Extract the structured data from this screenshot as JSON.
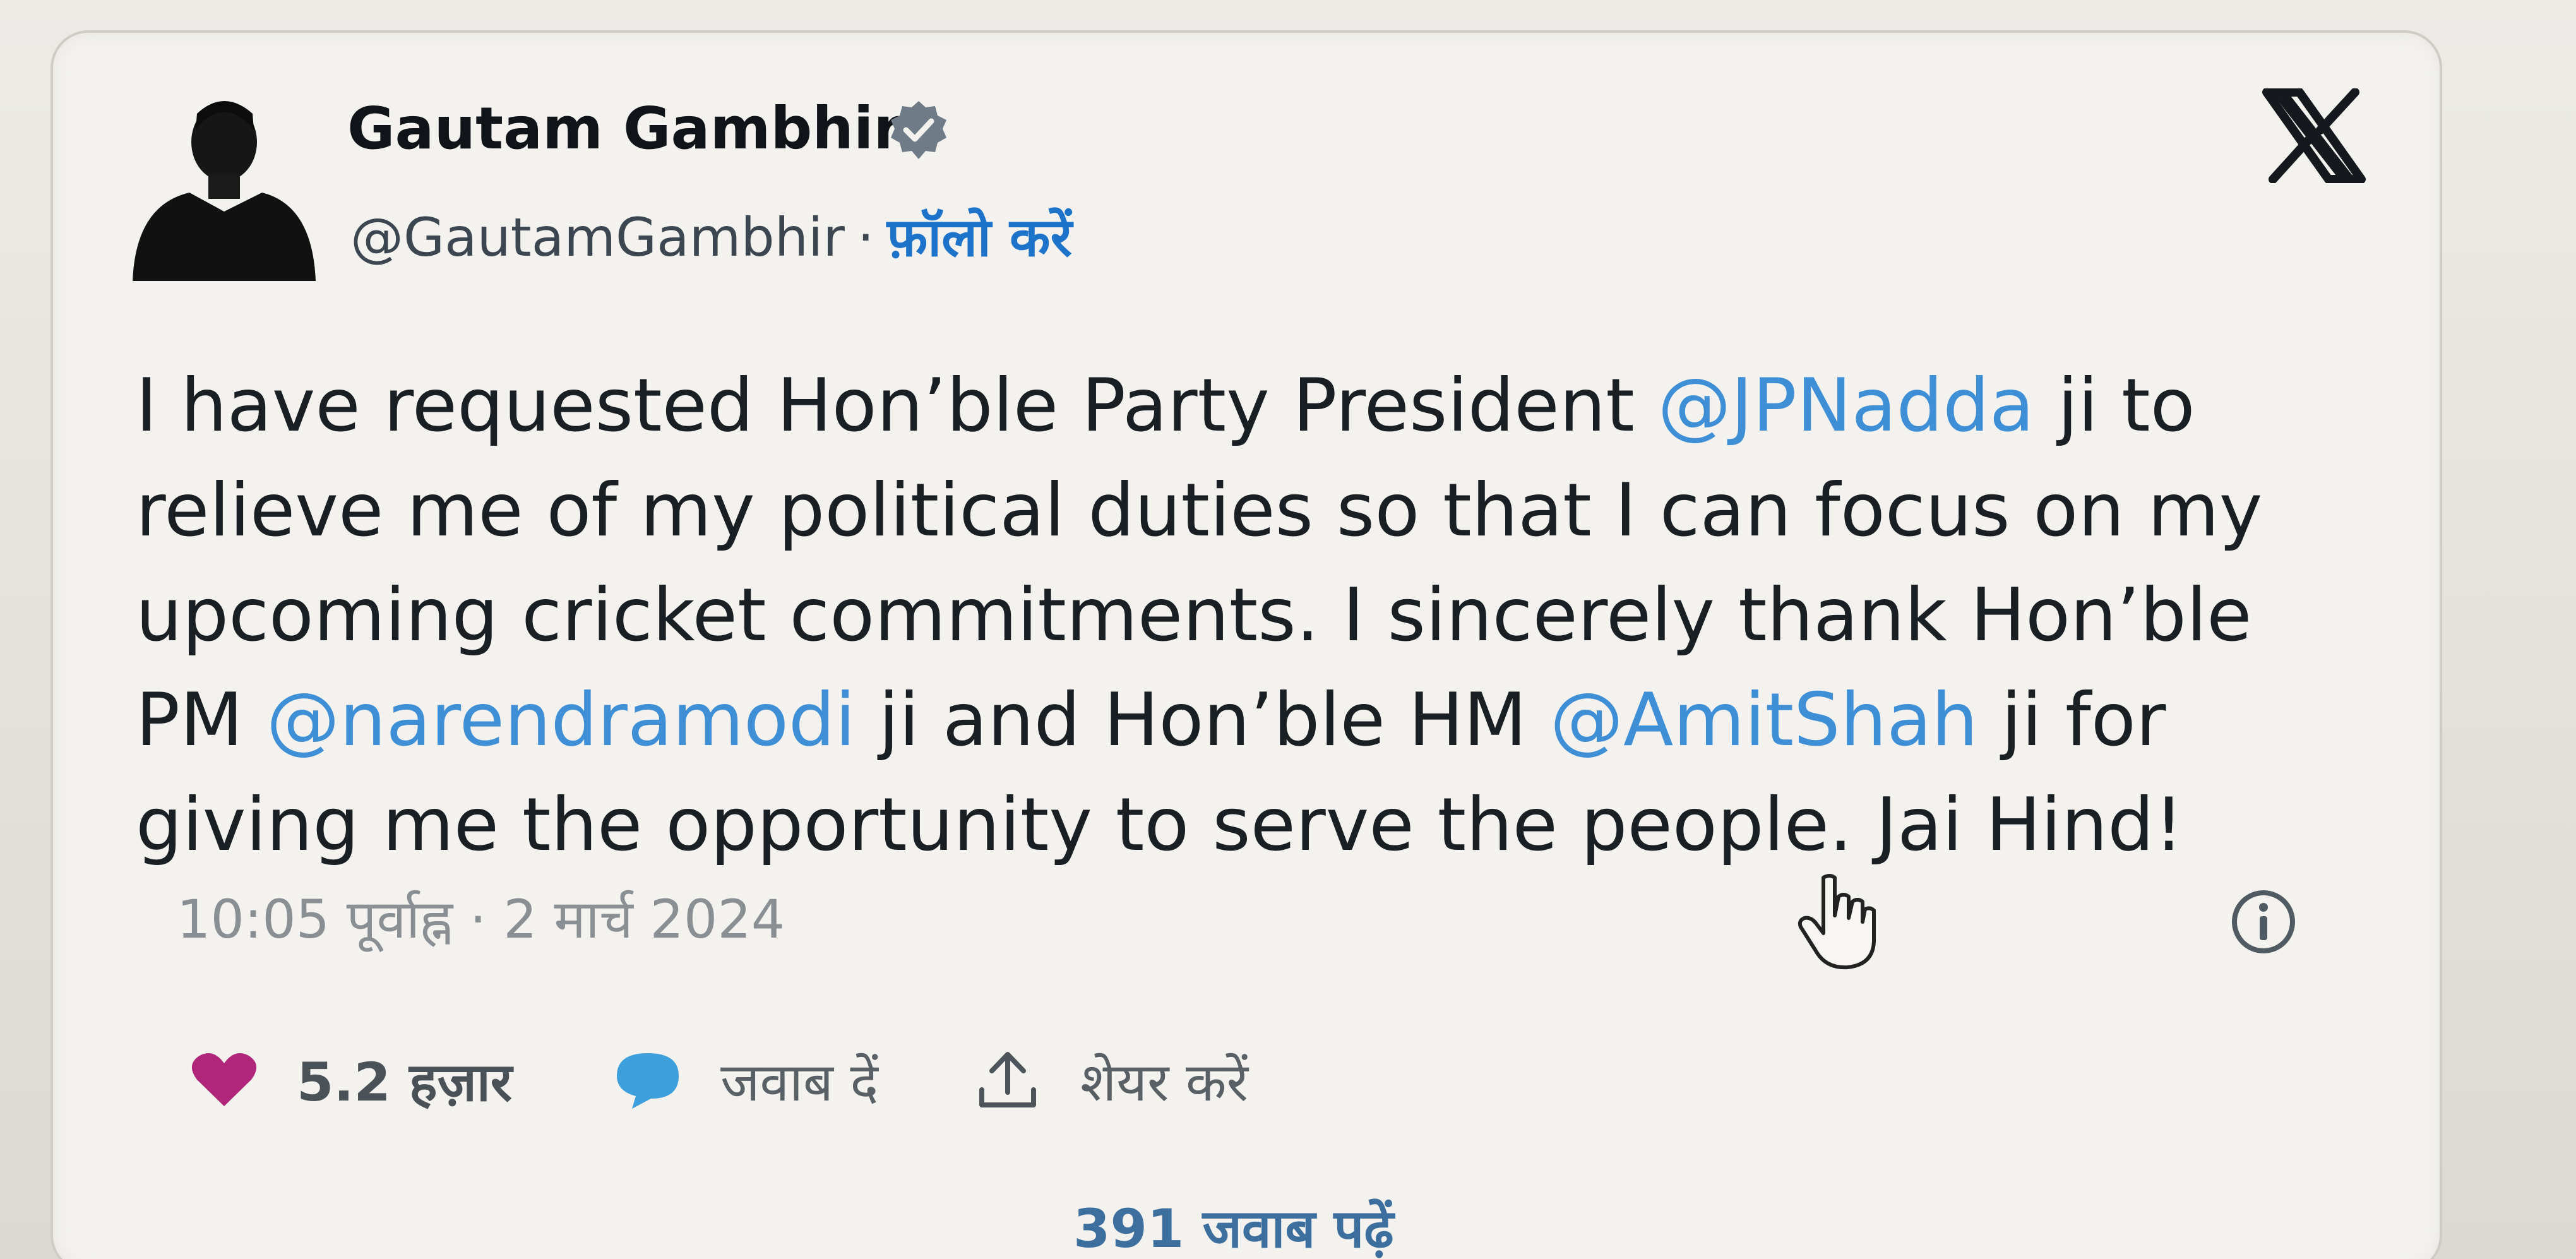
{
  "author": {
    "name": "Gautam Gambhir",
    "handle": "@GautamGambhir",
    "separator": "·",
    "follow_label": "फ़ॉलो करें"
  },
  "icons": {
    "verified": "verified-badge-icon",
    "brand": "x-logo-icon",
    "info": "info-icon",
    "like": "heart-icon",
    "reply": "speech-bubble-icon",
    "share": "share-arrow-icon",
    "cursor": "hand-pointer-icon"
  },
  "tweet": {
    "l1_a": "I have requested Hon’ble Party President ",
    "mention1": "@JPNadda",
    "l1_b": " ji to",
    "l2": "relieve me of my political duties so that I can focus on my",
    "l3": "upcoming cricket commitments. I sincerely thank Hon’ble",
    "l4_a": "PM ",
    "mention2": "@narendramodi",
    "l4_b": " ji and Hon’ble HM ",
    "mention3": "@AmitShah",
    "l4_c": " ji for",
    "l5": "giving me the opportunity to serve the people. Jai Hind!"
  },
  "timestamp": "10:05 पूर्वाह्न · 2 मार्च 2024",
  "actions": {
    "likes": "5.2 हज़ार",
    "reply": "जवाब दें",
    "share": "शेयर करें"
  },
  "read_replies": "391 जवाब पढ़ें",
  "colors": {
    "link": "#1d72c9",
    "mention": "#3f8fd6",
    "like": "#b0267a",
    "reply": "#3d9fdc",
    "text": "#1a1f24"
  }
}
